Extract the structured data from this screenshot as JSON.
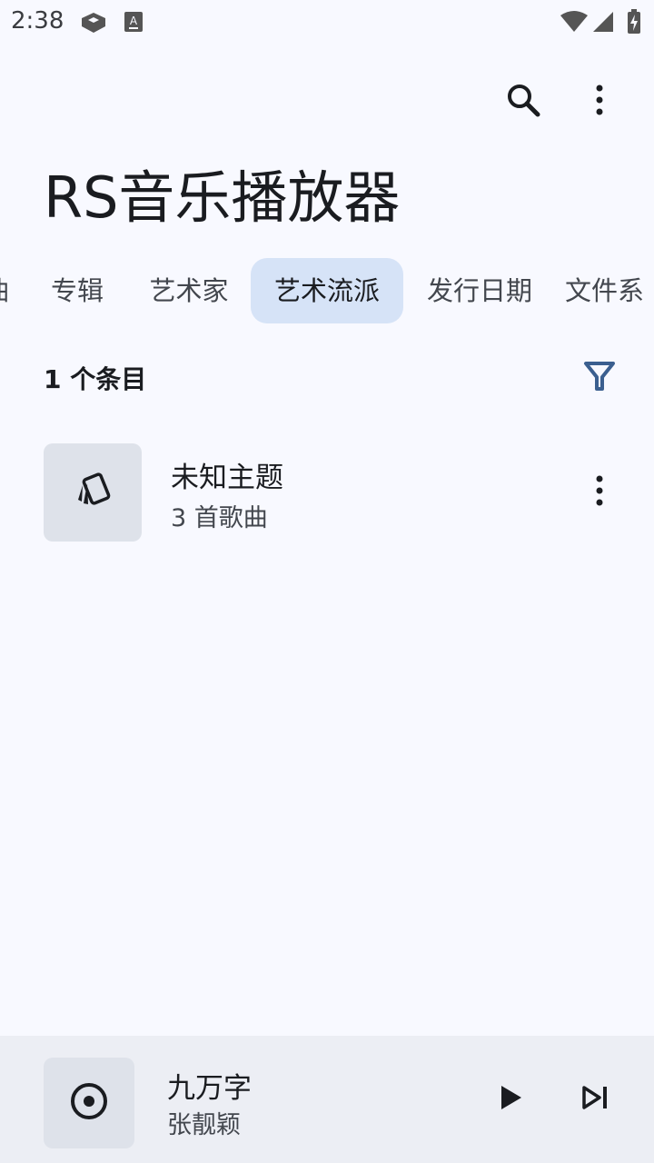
{
  "status_bar": {
    "time": "2:38",
    "icons": [
      "sim-card-icon",
      "keyboard-a-icon",
      "wifi-icon",
      "cell-signal-icon",
      "battery-charging-icon"
    ]
  },
  "app_bar": {
    "title": "RS音乐播放器",
    "actions": [
      "search-icon",
      "more-vert-icon"
    ]
  },
  "tabs": [
    {
      "label": "曲",
      "active": false
    },
    {
      "label": "专辑",
      "active": false
    },
    {
      "label": "艺术家",
      "active": false
    },
    {
      "label": "艺术流派",
      "active": true
    },
    {
      "label": "发行日期",
      "active": false
    },
    {
      "label": "文件系",
      "active": false
    }
  ],
  "list_header": {
    "count_label": "1 个条目",
    "filter_icon": "filter-icon"
  },
  "items": [
    {
      "title": "未知主题",
      "subtitle": "3 首歌曲",
      "icon": "genre-cards-icon"
    }
  ],
  "mini_player": {
    "title": "九万字",
    "artist": "张靓颖",
    "icon": "disc-icon",
    "controls": [
      "play-icon",
      "skip-next-icon"
    ]
  },
  "colors": {
    "background": "#F8F9FF",
    "tab_active_bg": "#D6E3F7",
    "filter_accent": "#3B5F8F",
    "mini_player_bg": "#ECEEF4",
    "thumb_bg": "#DEE2EA"
  }
}
